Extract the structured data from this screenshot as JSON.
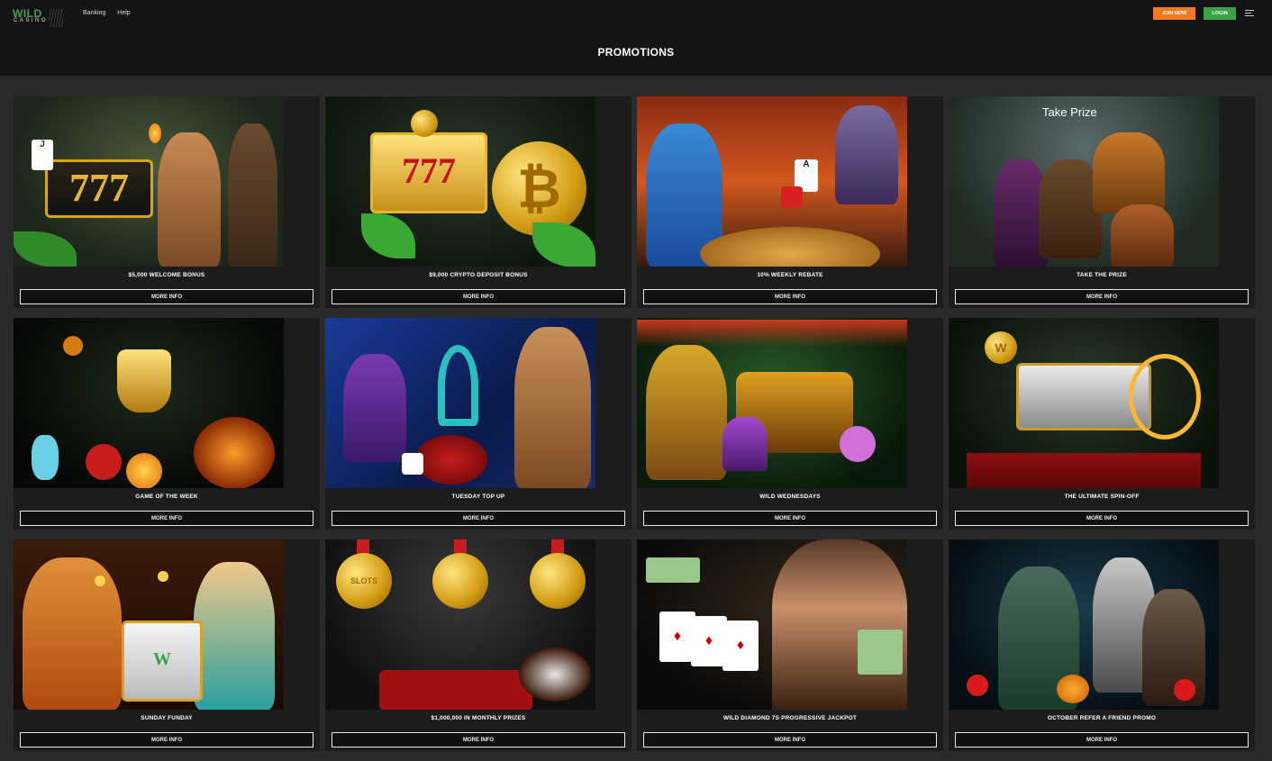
{
  "header": {
    "logo_top": "WILD",
    "logo_bottom": "CASINO",
    "nav": [
      "Banking",
      "Help"
    ],
    "join_label": "JOIN NOW",
    "login_label": "LOGIN",
    "menu_icon": "hamburger-menu-icon"
  },
  "page_title": "PROMOTIONS",
  "promotions": [
    {
      "title": "$5,000 WELCOME BONUS",
      "button": "MORE INFO"
    },
    {
      "title": "$9,000 CRYPTO DEPOSIT BONUS",
      "button": "MORE INFO"
    },
    {
      "title": "10% WEEKLY REBATE",
      "button": "MORE INFO"
    },
    {
      "title": "TAKE THE PRIZE",
      "button": "MORE INFO",
      "image_text": "Take Prize"
    },
    {
      "title": "GAME OF THE WEEK",
      "button": "MORE INFO"
    },
    {
      "title": "TUESDAY TOP UP",
      "button": "MORE INFO"
    },
    {
      "title": "WILD WEDNESDAYS",
      "button": "MORE INFO"
    },
    {
      "title": "THE ULTIMATE SPIN-OFF",
      "button": "MORE INFO"
    },
    {
      "title": "SUNDAY FUNDAY",
      "button": "MORE INFO"
    },
    {
      "title": "$1,000,000 IN MONTHLY PRIZES",
      "button": "MORE INFO"
    },
    {
      "title": "WILD DIAMOND 7S PROGRESSIVE JACKPOT",
      "button": "MORE INFO"
    },
    {
      "title": "OCTOBER REFER A FRIEND PROMO",
      "button": "MORE INFO"
    }
  ],
  "colors": {
    "brand_green": "#3fa34d",
    "join_orange": "#ef7d1f",
    "login_green": "#3aa348",
    "background": "#2a2a2a",
    "header_bg": "#141414"
  }
}
